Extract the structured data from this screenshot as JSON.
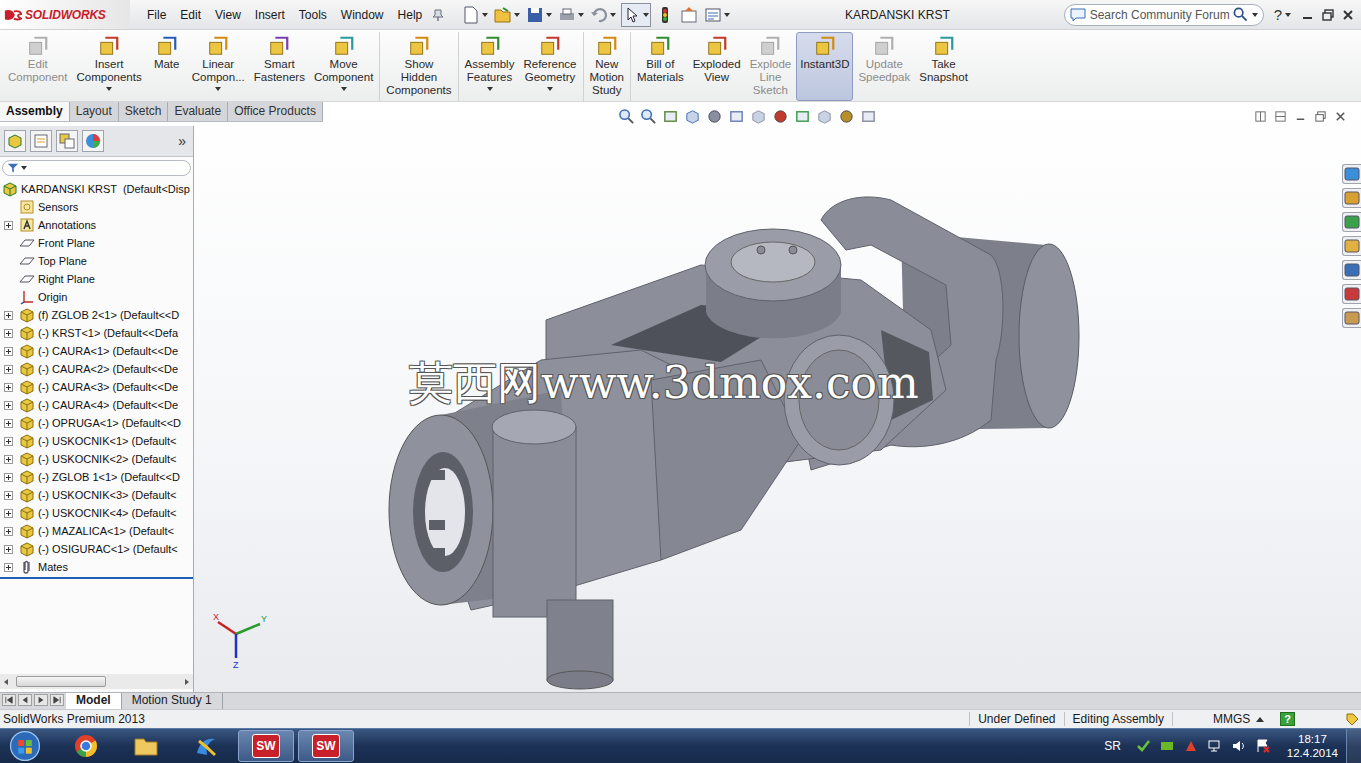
{
  "app": {
    "logo": "SOLIDWORKS",
    "title": "KARDANSKI KRST"
  },
  "menu": [
    "File",
    "Edit",
    "View",
    "Insert",
    "Tools",
    "Window",
    "Help"
  ],
  "search": {
    "placeholder": "Search Community Forum"
  },
  "help": {
    "label": "?"
  },
  "command_groups": [
    [
      {
        "lines": [
          "Edit",
          "Component"
        ],
        "disabled": true,
        "dropdown": false,
        "selected": false
      },
      {
        "lines": [
          "Insert",
          "Components"
        ],
        "disabled": false,
        "dropdown": true,
        "selected": false
      },
      {
        "lines": [
          "Mate"
        ],
        "disabled": false,
        "dropdown": false,
        "selected": false
      },
      {
        "lines": [
          "Linear",
          "Compon..."
        ],
        "disabled": false,
        "dropdown": true,
        "selected": false
      },
      {
        "lines": [
          "Smart",
          "Fasteners"
        ],
        "disabled": false,
        "dropdown": false,
        "selected": false
      },
      {
        "lines": [
          "Move",
          "Component"
        ],
        "disabled": false,
        "dropdown": true,
        "selected": false
      }
    ],
    [
      {
        "lines": [
          "Show",
          "Hidden",
          "Components"
        ],
        "disabled": false,
        "dropdown": false,
        "selected": false
      }
    ],
    [
      {
        "lines": [
          "Assembly",
          "Features"
        ],
        "disabled": false,
        "dropdown": true,
        "selected": false
      },
      {
        "lines": [
          "Reference",
          "Geometry"
        ],
        "disabled": false,
        "dropdown": true,
        "selected": false
      }
    ],
    [
      {
        "lines": [
          "New",
          "Motion",
          "Study"
        ],
        "disabled": false,
        "dropdown": false,
        "selected": false
      }
    ],
    [
      {
        "lines": [
          "Bill of",
          "Materials"
        ],
        "disabled": false,
        "dropdown": false,
        "selected": false
      },
      {
        "lines": [
          "Exploded",
          "View"
        ],
        "disabled": false,
        "dropdown": false,
        "selected": false
      },
      {
        "lines": [
          "Explode",
          "Line",
          "Sketch"
        ],
        "disabled": true,
        "dropdown": false,
        "selected": false
      },
      {
        "lines": [
          "Instant3D"
        ],
        "disabled": false,
        "dropdown": false,
        "selected": true
      },
      {
        "lines": [
          "Update",
          "Speedpak"
        ],
        "disabled": true,
        "dropdown": false,
        "selected": false
      },
      {
        "lines": [
          "Take",
          "Snapshot"
        ],
        "disabled": false,
        "dropdown": false,
        "selected": false
      }
    ]
  ],
  "tabs": [
    {
      "label": "Assembly",
      "selected": true
    },
    {
      "label": "Layout",
      "selected": false
    },
    {
      "label": "Sketch",
      "selected": false
    },
    {
      "label": "Evaluate",
      "selected": false
    },
    {
      "label": "Office Products",
      "selected": false
    }
  ],
  "panel": {
    "more": "»"
  },
  "tree": {
    "root": {
      "label": "KARDANSKI KRST  (Default<Disp",
      "kind": "assembly"
    },
    "items": [
      {
        "label": "Sensors",
        "kind": "sensor",
        "expandable": false
      },
      {
        "label": "Annotations",
        "kind": "annotation",
        "expandable": true
      },
      {
        "label": "Front Plane",
        "kind": "plane",
        "expandable": false
      },
      {
        "label": "Top Plane",
        "kind": "plane",
        "expandable": false
      },
      {
        "label": "Right Plane",
        "kind": "plane",
        "expandable": false
      },
      {
        "label": "Origin",
        "kind": "origin",
        "expandable": false
      },
      {
        "label": "(f) ZGLOB 2<1> (Default<<D",
        "kind": "part",
        "expandable": true
      },
      {
        "label": "(-) KRST<1> (Default<<Defa",
        "kind": "part",
        "expandable": true
      },
      {
        "label": "(-) CAURA<1> (Default<<De",
        "kind": "part",
        "expandable": true
      },
      {
        "label": "(-) CAURA<2> (Default<<De",
        "kind": "part",
        "expandable": true
      },
      {
        "label": "(-) CAURA<3> (Default<<De",
        "kind": "part",
        "expandable": true
      },
      {
        "label": "(-) CAURA<4> (Default<<De",
        "kind": "part",
        "expandable": true
      },
      {
        "label": "(-) OPRUGA<1> (Default<<D",
        "kind": "part",
        "expandable": true
      },
      {
        "label": "(-) USKOCNIK<1> (Default<",
        "kind": "part",
        "expandable": true
      },
      {
        "label": "(-) USKOCNIK<2> (Default<",
        "kind": "part",
        "expandable": true
      },
      {
        "label": "(-) ZGLOB 1<1> (Default<<D",
        "kind": "part",
        "expandable": true
      },
      {
        "label": "(-) USKOCNIK<3> (Default<",
        "kind": "part",
        "expandable": true
      },
      {
        "label": "(-) USKOCNIK<4> (Default<",
        "kind": "part",
        "expandable": true
      },
      {
        "label": "(-) MAZALICA<1> (Default<",
        "kind": "part",
        "expandable": true
      },
      {
        "label": "(-) OSIGURAC<1> (Default<",
        "kind": "part",
        "expandable": true
      },
      {
        "label": "Mates",
        "kind": "mates",
        "expandable": true
      }
    ]
  },
  "viewport": {
    "watermark": "莫西网www.3dmox.com",
    "axes": [
      {
        "label": "X",
        "color": "#cc2222"
      },
      {
        "label": "Y",
        "color": "#2a9a2a"
      },
      {
        "label": "Z",
        "color": "#2233bb"
      }
    ]
  },
  "bottom_tabs": [
    {
      "label": "Model",
      "selected": true
    },
    {
      "label": "Motion Study 1",
      "selected": false
    }
  ],
  "status_bar": {
    "product": "SolidWorks Premium 2013",
    "fields": [
      "Under Defined",
      "Editing Assembly"
    ],
    "units": "MMGS",
    "help": "?"
  },
  "taskbar": {
    "apps": [
      {
        "kind": "chrome",
        "active": false
      },
      {
        "kind": "explorer",
        "active": false
      },
      {
        "kind": "paint",
        "active": false
      },
      {
        "kind": "solidworks",
        "label": "SW",
        "active": true
      },
      {
        "kind": "solidworks",
        "label": "SW",
        "active": true
      }
    ],
    "language": "SR",
    "time": "18:17",
    "date": "12.4.2014"
  }
}
